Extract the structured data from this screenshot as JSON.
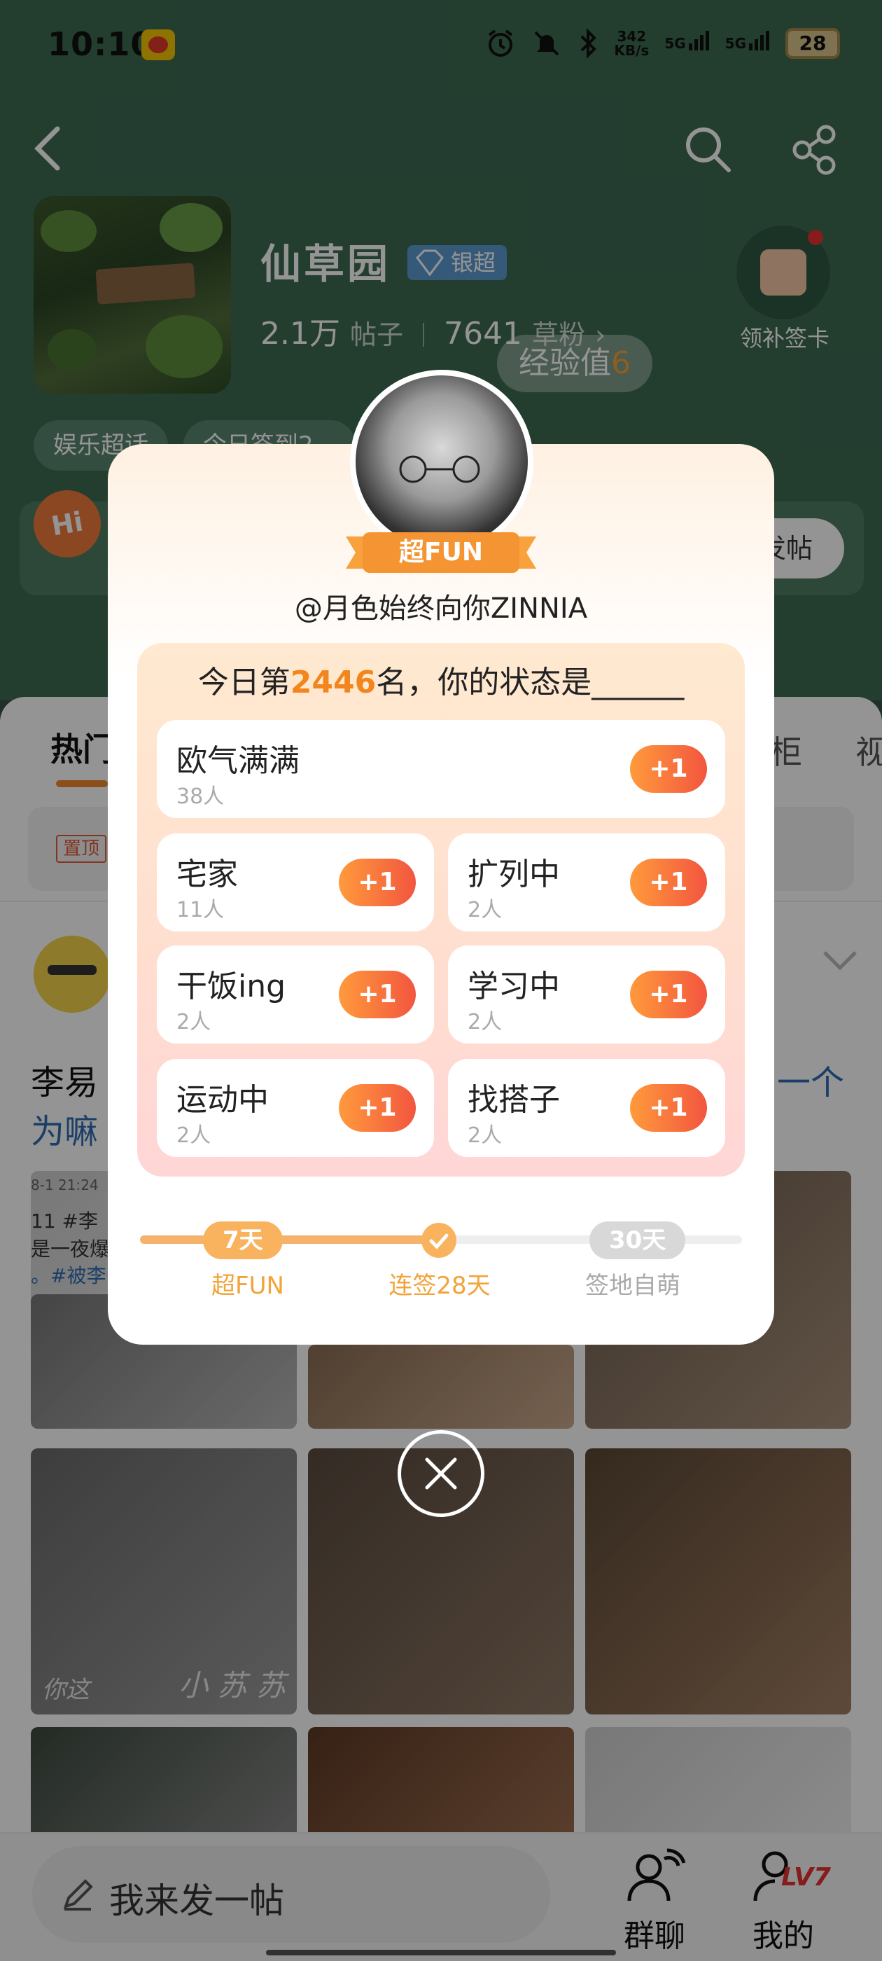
{
  "status_bar": {
    "time": "10:10",
    "net_speed_value": "342",
    "net_speed_unit": "KB/s",
    "signal1_label": "5G",
    "signal2_label": "5G",
    "battery": "28"
  },
  "header": {
    "community_name": "仙草园",
    "badge": "银超",
    "posts_count": "2.1万",
    "posts_label": "帖子",
    "fans_count": "7641",
    "fans_label": "草粉",
    "exp_label": "经验值",
    "exp_value": "6",
    "checkin_label": "领补签卡",
    "chips": [
      "娱乐超话",
      "今日签到2..."
    ],
    "hi_text": "Hi",
    "post_button_text": "发帖"
  },
  "feed": {
    "tab_active": "热门",
    "tab_right1": "柜",
    "tab_right2": "视",
    "pin_label": "置顶",
    "post_author_line": "李易",
    "post_hash_line": "为嘛",
    "post_right_text": "一个",
    "repost_time": "8-1 21:24",
    "repost_line1": "11  #李",
    "repost_line2": "是一夜爆",
    "repost_line3": "。#被李",
    "watermark1": "小 苏 苏",
    "watermark2": "你这"
  },
  "modal": {
    "ribbon_label": "超FUN",
    "username": "@月色始终向你ZINNIA",
    "question_prefix": "今日第",
    "rank": "2446",
    "question_suffix": "名，你的状态是______",
    "plus_label": "+1",
    "options": [
      {
        "name": "欧气满满",
        "count": "38人"
      },
      {
        "name": "宅家",
        "count": "11人"
      },
      {
        "name": "扩列中",
        "count": "2人"
      },
      {
        "name": "干饭ing",
        "count": "2人"
      },
      {
        "name": "学习中",
        "count": "2人"
      },
      {
        "name": "运动中",
        "count": "2人"
      },
      {
        "name": "找搭子",
        "count": "2人"
      }
    ],
    "progress": {
      "milestone1": "7天",
      "milestone1_label": "超FUN",
      "current_label": "连签28天",
      "milestone3": "30天",
      "milestone3_label": "签地自萌",
      "fill_fraction": 0.48
    }
  },
  "bottom": {
    "compose_placeholder": "我来发一帖",
    "tab_group": "群聊",
    "tab_me": "我的",
    "level": "LV7"
  },
  "colors": {
    "accent_orange": "#f2851b",
    "plus_gradient_start": "#ff9a3c",
    "plus_gradient_end": "#f2563f",
    "header_green": "#3d6b52",
    "badge_blue": "#5c9bd1"
  }
}
